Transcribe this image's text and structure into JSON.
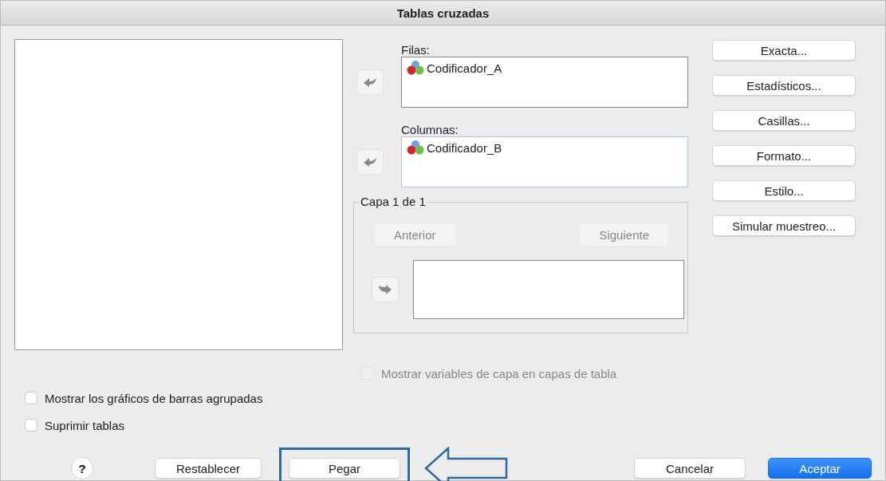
{
  "window": {
    "title": "Tablas cruzadas"
  },
  "rows": {
    "label": "Filas:",
    "variables": [
      "Codificador_A"
    ]
  },
  "columns": {
    "label": "Columnas:",
    "variables": [
      "Codificador_B"
    ]
  },
  "layer": {
    "title": "Capa 1 de 1",
    "previous": {
      "label": "Anterior",
      "disabled": true
    },
    "next": {
      "label": "Siguiente",
      "disabled": true
    }
  },
  "layer_option": {
    "label": "Mostrar variables de capa en capas de tabla",
    "checked": false,
    "disabled": true
  },
  "side_buttons": [
    "Exacta...",
    "Estadísticos...",
    "Casillas...",
    "Formato...",
    "Estilo...",
    "Simular muestreo..."
  ],
  "options": [
    {
      "label": "Mostrar los gráficos de barras agrupadas",
      "checked": false
    },
    {
      "label": "Suprimir tablas",
      "checked": false
    }
  ],
  "footer": {
    "help": "?",
    "buttons": [
      {
        "label": "Restablecer",
        "kind": "normal"
      },
      {
        "label": "Pegar",
        "kind": "highlighted"
      },
      {
        "label": "Cancelar",
        "kind": "normal"
      },
      {
        "label": "Aceptar",
        "kind": "default"
      }
    ]
  }
}
